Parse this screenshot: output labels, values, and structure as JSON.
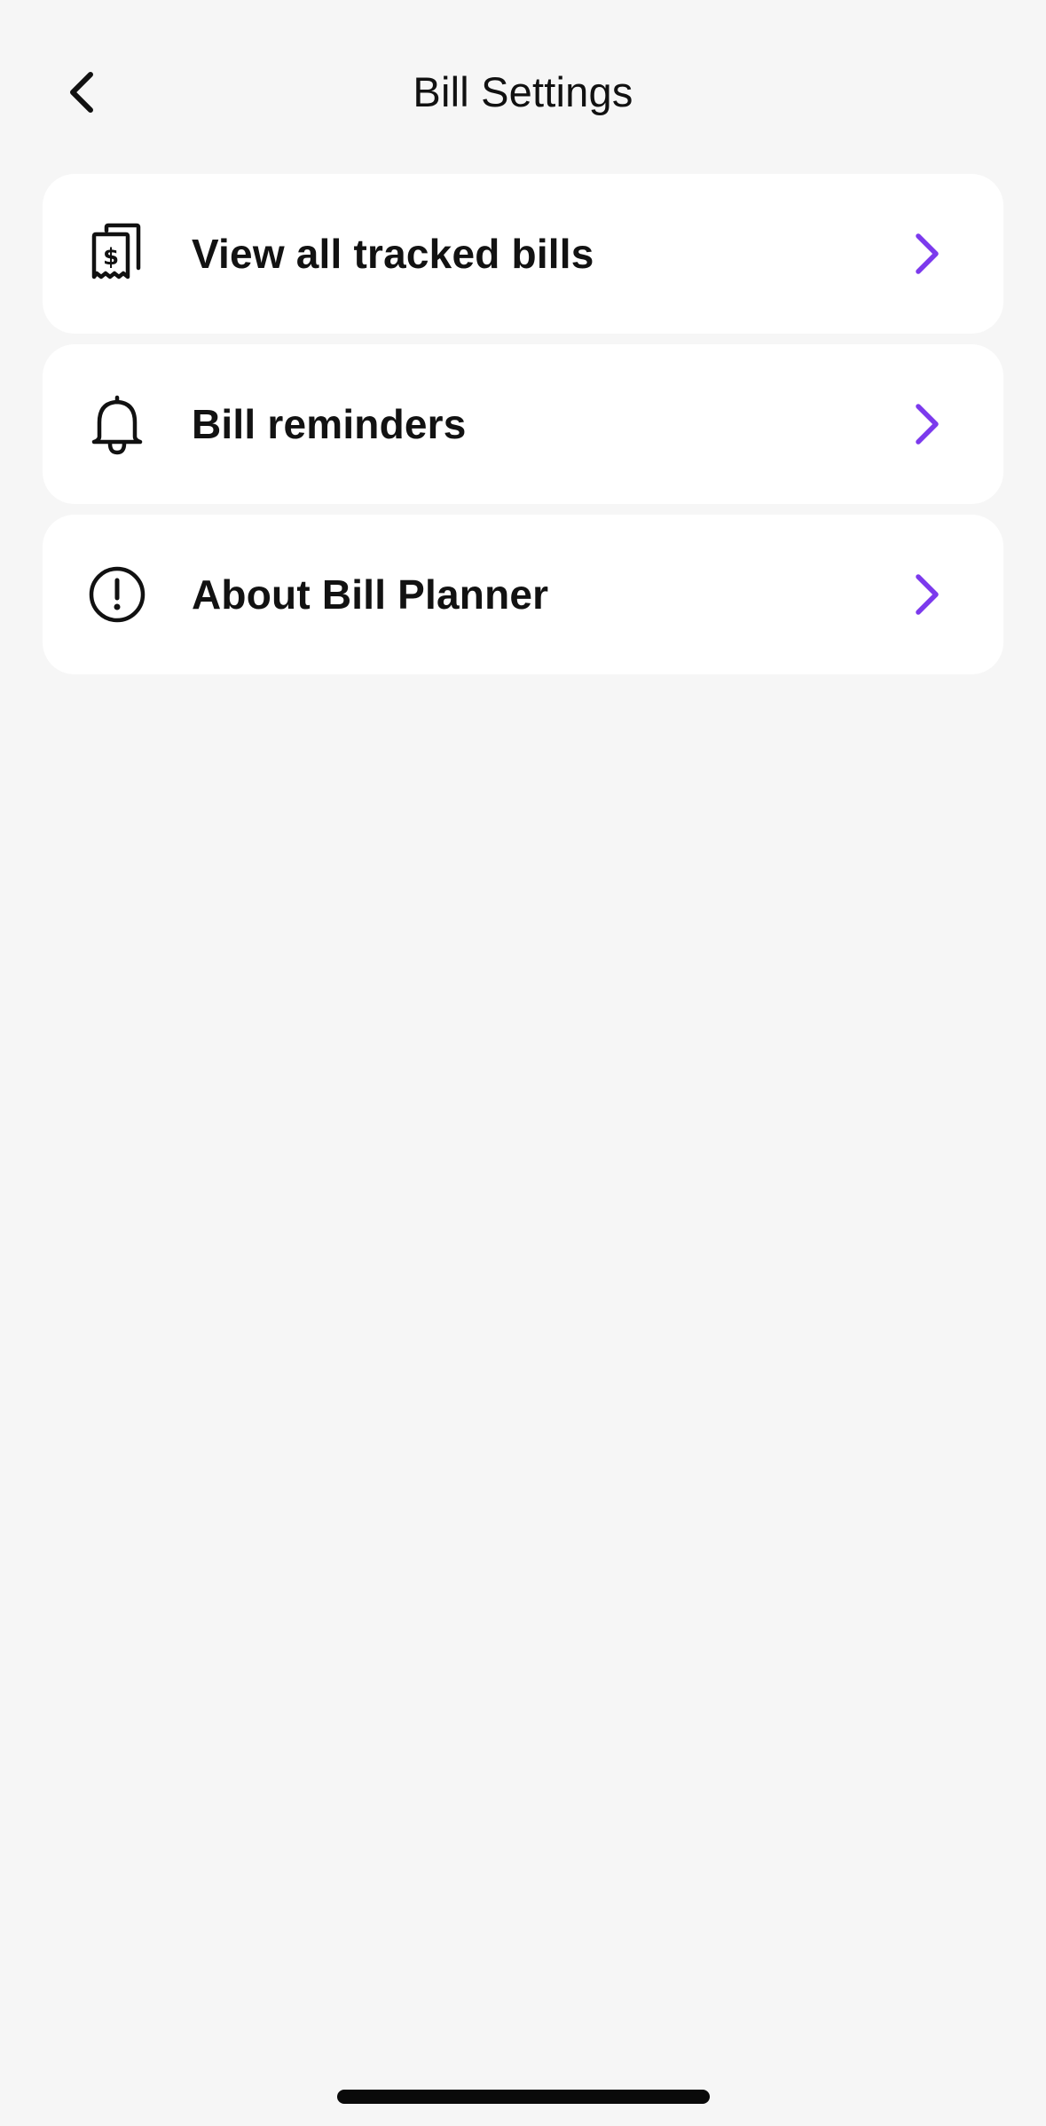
{
  "header": {
    "title": "Bill Settings",
    "back_icon": "chevron-left-icon"
  },
  "menu": {
    "items": [
      {
        "label": "View all tracked bills",
        "icon": "receipt-dollar-icon"
      },
      {
        "label": "Bill reminders",
        "icon": "bell-icon"
      },
      {
        "label": "About Bill Planner",
        "icon": "info-circle-icon"
      }
    ],
    "chevron_icon": "chevron-right-icon"
  },
  "colors": {
    "background": "#f6f6f6",
    "card": "#ffffff",
    "text": "#121212",
    "accent": "#7c3aed",
    "home_indicator": "#0a0a0a"
  }
}
